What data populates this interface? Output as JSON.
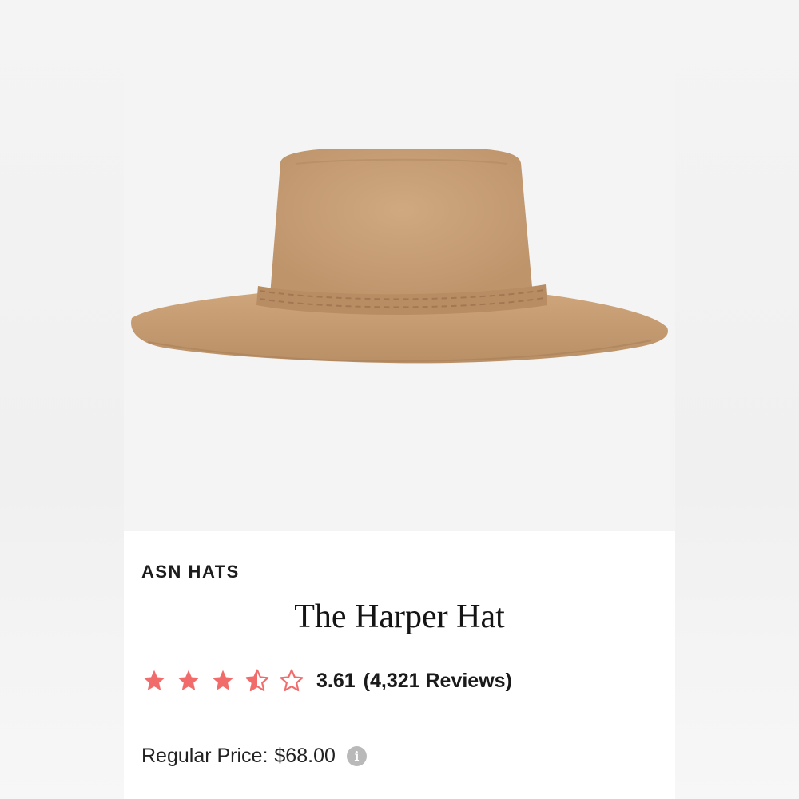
{
  "product": {
    "brand": "ASN HATS",
    "title": "The Harper Hat",
    "rating": {
      "value_text": "3.61",
      "reviews_text": "(4,321 Reviews)",
      "stars_filled": 3.5,
      "stars_total": 5,
      "star_color": "#f26b6b"
    },
    "price": {
      "label": "Regular Price:",
      "value": "$68.00"
    },
    "image": {
      "subject": "hat-product-image",
      "hat_color": "#c8a079"
    }
  },
  "icons": {
    "star": "star-icon",
    "info": "info-icon"
  }
}
